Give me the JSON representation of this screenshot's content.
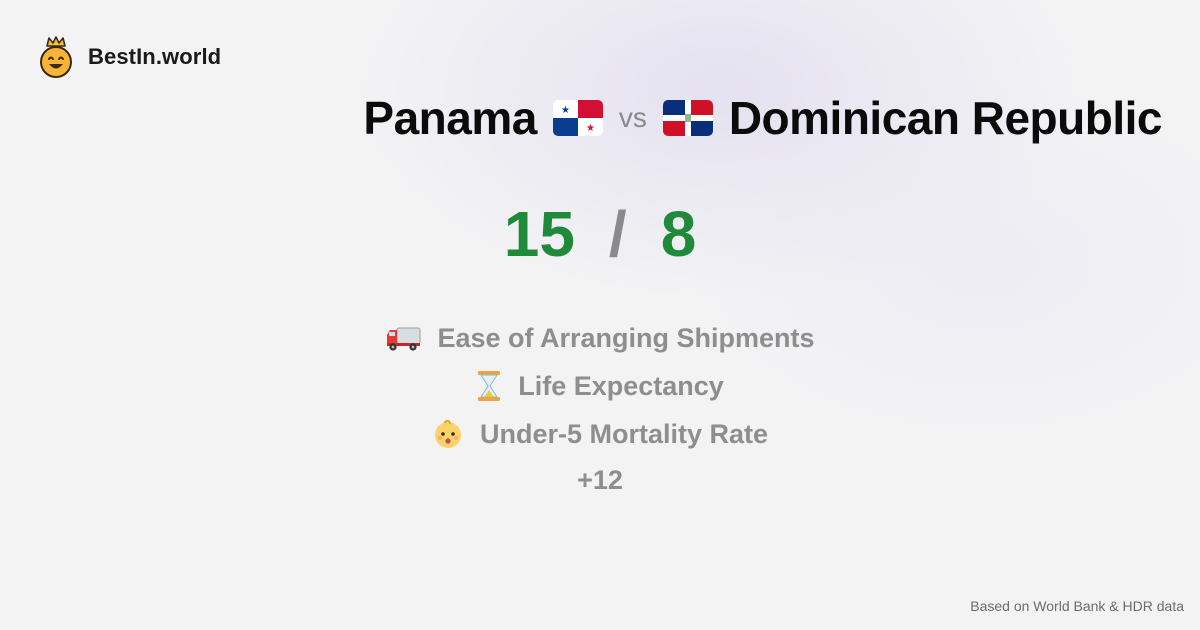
{
  "brand": {
    "name": "BestIn.world",
    "logo_icon": "crown-smiley-icon"
  },
  "title": {
    "left_country": "Panama",
    "left_flag": "panama-flag-icon",
    "separator": "vs",
    "right_country": "Dominican Republic",
    "right_flag": "dominican-republic-flag-icon"
  },
  "score": {
    "left": "15",
    "separator": "/",
    "right": "8",
    "color": "#1e8a3a"
  },
  "metrics": [
    {
      "icon": "delivery-truck-icon",
      "label": "Ease of Arranging Shipments"
    },
    {
      "icon": "hourglass-icon",
      "label": "Life Expectancy"
    },
    {
      "icon": "baby-face-icon",
      "label": "Under-5 Mortality Rate"
    }
  ],
  "more_count": "+12",
  "footer": "Based on World Bank & HDR data"
}
